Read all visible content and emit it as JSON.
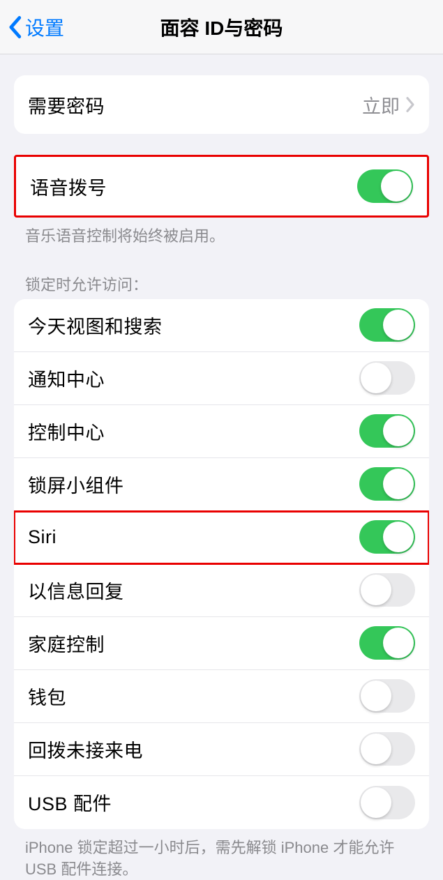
{
  "nav": {
    "back_label": "设置",
    "title": "面容 ID与密码"
  },
  "group1": {
    "require_passcode": "需要密码",
    "require_passcode_value": "立即"
  },
  "group2": {
    "voice_dial": "语音拨号",
    "voice_dial_on": true,
    "footer": "音乐语音控制将始终被启用。"
  },
  "group3": {
    "header": "锁定时允许访问：",
    "items": [
      {
        "label": "今天视图和搜索",
        "on": true,
        "highlighted": false
      },
      {
        "label": "通知中心",
        "on": false,
        "highlighted": false
      },
      {
        "label": "控制中心",
        "on": true,
        "highlighted": false
      },
      {
        "label": "锁屏小组件",
        "on": true,
        "highlighted": false
      },
      {
        "label": "Siri",
        "on": true,
        "highlighted": true
      },
      {
        "label": "以信息回复",
        "on": false,
        "highlighted": false
      },
      {
        "label": "家庭控制",
        "on": true,
        "highlighted": false
      },
      {
        "label": "钱包",
        "on": false,
        "highlighted": false
      },
      {
        "label": "回拨未接来电",
        "on": false,
        "highlighted": false
      },
      {
        "label": "USB 配件",
        "on": false,
        "highlighted": false
      }
    ],
    "footer": "iPhone 锁定超过一小时后，需先解锁 iPhone 才能允许USB 配件连接。"
  }
}
